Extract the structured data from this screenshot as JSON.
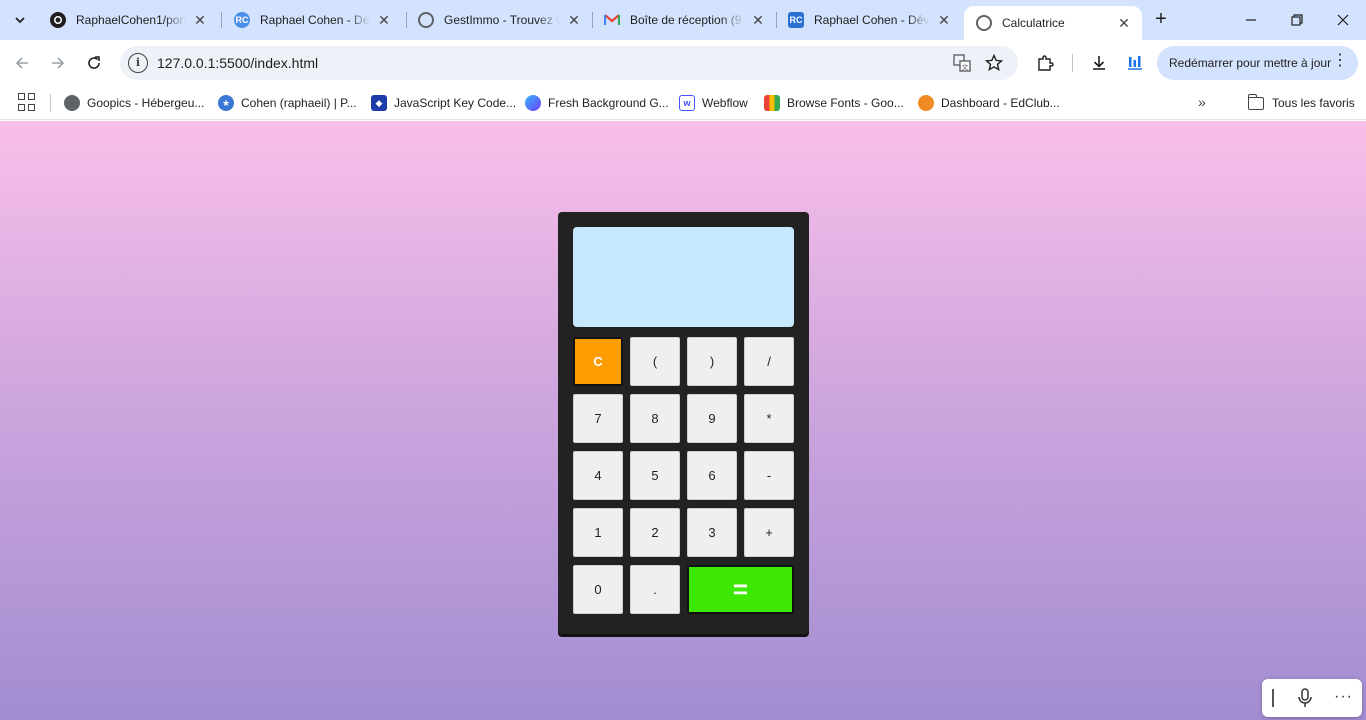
{
  "browser": {
    "tabs": [
      {
        "title": "RaphaelCohen1/portf",
        "favicon": "github-icon",
        "active": false
      },
      {
        "title": "Raphael Cohen - Dév",
        "favicon": "rc-logo-icon",
        "active": false
      },
      {
        "title": "GestImmo - Trouvez v",
        "favicon": "globe-icon",
        "active": false
      },
      {
        "title": "Boîte de réception (9",
        "favicon": "gmail-icon",
        "active": false
      },
      {
        "title": "Raphael Cohen - Dév",
        "favicon": "rc-logo-icon",
        "active": false
      },
      {
        "title": "Calculatrice",
        "favicon": "globe-icon",
        "active": true
      }
    ],
    "address": {
      "url": "127.0.0.1:5500/index.html"
    },
    "update_button_label": "Redémarrer pour mettre à jour",
    "bookmarks": [
      {
        "label": "Goopics - Hébergeu...",
        "icon": "globe-icon"
      },
      {
        "label": "Cohen (raphaeil) | P...",
        "icon": "star-badge-icon"
      },
      {
        "label": "JavaScript Key Code...",
        "icon": "keycode-icon"
      },
      {
        "label": "Fresh Background G...",
        "icon": "gradient-icon"
      },
      {
        "label": "Webflow",
        "icon": "webflow-icon"
      },
      {
        "label": "Browse Fonts - Goo...",
        "icon": "google-fonts-icon"
      },
      {
        "label": "Dashboard - EdClub...",
        "icon": "edclub-icon"
      }
    ],
    "all_bookmarks_label": "Tous les favoris"
  },
  "calculator": {
    "display_value": "",
    "keys": [
      {
        "label": "C",
        "kind": "clear"
      },
      {
        "label": "(",
        "kind": "operator"
      },
      {
        "label": ")",
        "kind": "operator"
      },
      {
        "label": "/",
        "kind": "operator"
      },
      {
        "label": "7",
        "kind": "digit"
      },
      {
        "label": "8",
        "kind": "digit"
      },
      {
        "label": "9",
        "kind": "digit"
      },
      {
        "label": "*",
        "kind": "operator"
      },
      {
        "label": "4",
        "kind": "digit"
      },
      {
        "label": "5",
        "kind": "digit"
      },
      {
        "label": "6",
        "kind": "digit"
      },
      {
        "label": "-",
        "kind": "operator"
      },
      {
        "label": "1",
        "kind": "digit"
      },
      {
        "label": "2",
        "kind": "digit"
      },
      {
        "label": "3",
        "kind": "digit"
      },
      {
        "label": "+",
        "kind": "operator"
      },
      {
        "label": "0",
        "kind": "digit"
      },
      {
        "label": ".",
        "kind": "digit"
      },
      {
        "label": "=",
        "kind": "equals"
      }
    ]
  },
  "colors": {
    "background_top": "#f9bfea",
    "background_bottom": "#a18dd1",
    "calculator_body": "#222222",
    "screen": "#c6e9fd",
    "clear_key": "#fe9d01",
    "equals_key": "#3de904"
  }
}
